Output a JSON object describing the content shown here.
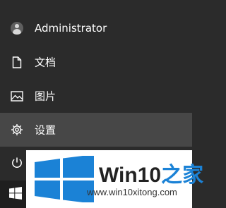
{
  "start_menu": {
    "items": [
      {
        "label": "Administrator",
        "icon": "user-avatar-icon"
      },
      {
        "label": "文档",
        "icon": "document-icon"
      },
      {
        "label": "图片",
        "icon": "picture-icon"
      },
      {
        "label": "设置",
        "icon": "gear-icon",
        "highlighted": true
      },
      {
        "label": "",
        "icon": "power-icon"
      }
    ]
  },
  "taskbar": {
    "start_icon": "windows-logo-icon"
  },
  "watermark": {
    "brand_prefix": "Win10",
    "brand_suffix": "之家",
    "url": "www.win10xitong.com",
    "brand_color": "#1b82d6"
  },
  "colors": {
    "menu_background": "#2b2b2b",
    "hover_background": "#474747",
    "taskbar_background": "#1f1f1f"
  }
}
